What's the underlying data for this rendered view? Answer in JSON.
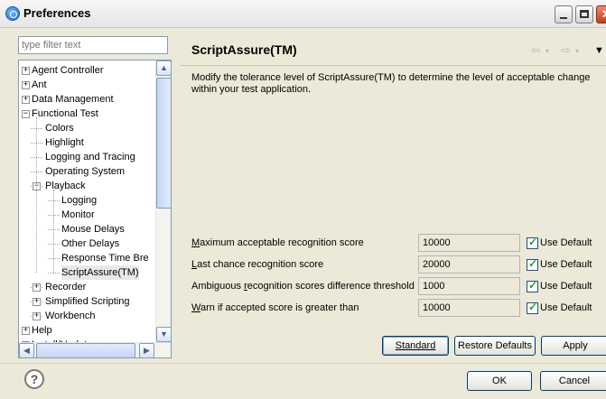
{
  "window": {
    "title": "Preferences"
  },
  "filter": {
    "placeholder": "type filter text"
  },
  "tree": [
    {
      "label": "Agent Controller",
      "level": 0,
      "expander": "+"
    },
    {
      "label": "Ant",
      "level": 0,
      "expander": "+"
    },
    {
      "label": "Data Management",
      "level": 0,
      "expander": "+"
    },
    {
      "label": "Functional Test",
      "level": 0,
      "expander": "−"
    },
    {
      "label": "Colors",
      "level": 1,
      "expander": ""
    },
    {
      "label": "Highlight",
      "level": 1,
      "expander": ""
    },
    {
      "label": "Logging and Tracing",
      "level": 1,
      "expander": ""
    },
    {
      "label": "Operating System",
      "level": 1,
      "expander": ""
    },
    {
      "label": "Playback",
      "level": 1,
      "expander": "−"
    },
    {
      "label": "Logging",
      "level": 2,
      "expander": ""
    },
    {
      "label": "Monitor",
      "level": 2,
      "expander": ""
    },
    {
      "label": "Mouse Delays",
      "level": 2,
      "expander": ""
    },
    {
      "label": "Other Delays",
      "level": 2,
      "expander": ""
    },
    {
      "label": "Response Time Bre",
      "level": 2,
      "expander": ""
    },
    {
      "label": "ScriptAssure(TM)",
      "level": 2,
      "expander": "",
      "selected": true
    },
    {
      "label": "Recorder",
      "level": 1,
      "expander": "+"
    },
    {
      "label": "Simplified Scripting",
      "level": 1,
      "expander": "+"
    },
    {
      "label": "Workbench",
      "level": 1,
      "expander": "+"
    },
    {
      "label": "Help",
      "level": 0,
      "expander": "+"
    },
    {
      "label": "Install/Update",
      "level": 0,
      "expander": "+"
    }
  ],
  "page": {
    "title": "ScriptAssure(TM)",
    "description": "Modify the tolerance level of ScriptAssure(TM) to determine the level of acceptable change within your test application.",
    "rows": [
      {
        "prefix": "",
        "mnemonic": "M",
        "rest": "aximum acceptable recognition score",
        "value": "10000",
        "use_default": "Use Default"
      },
      {
        "prefix": "",
        "mnemonic": "L",
        "rest": "ast chance recognition score",
        "value": "20000",
        "use_default": "Use Default"
      },
      {
        "prefix": "Ambiguous ",
        "mnemonic": "r",
        "rest": "ecognition scores difference threshold",
        "value": "1000",
        "use_default": "Use Default"
      },
      {
        "prefix": "",
        "mnemonic": "W",
        "rest": "arn if accepted score is greater than",
        "value": "10000",
        "use_default": "Use Default"
      }
    ],
    "buttons": {
      "standard": "Standard",
      "restore_defaults": "Restore Defaults",
      "apply": "Apply"
    }
  },
  "footer": {
    "help_symbol": "?",
    "ok": "OK",
    "cancel": "Cancel"
  }
}
